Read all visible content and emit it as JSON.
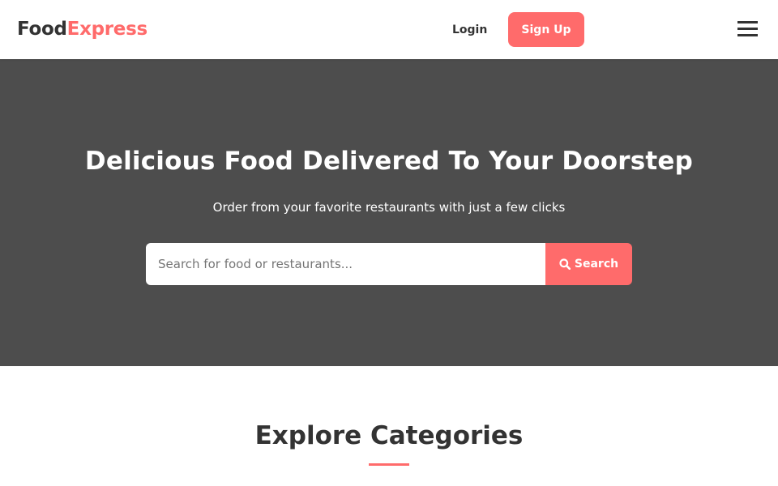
{
  "header": {
    "logo": {
      "part1": "Food",
      "part2": "Express"
    },
    "login_label": "Login",
    "signup_label": "Sign Up",
    "menu_icon": "hamburger-icon"
  },
  "hero": {
    "title": "Delicious Food Delivered To Your Doorstep",
    "subtitle": "Order from your favorite restaurants with just a few clicks",
    "search": {
      "placeholder": "Search for food or restaurants...",
      "value": "",
      "button_label": "Search",
      "button_icon": "search-icon"
    }
  },
  "categories": {
    "title": "Explore Categories"
  },
  "colors": {
    "accent": "#ff6b6b",
    "hero_bg": "#4d4d4d",
    "text_dark": "#333333"
  }
}
